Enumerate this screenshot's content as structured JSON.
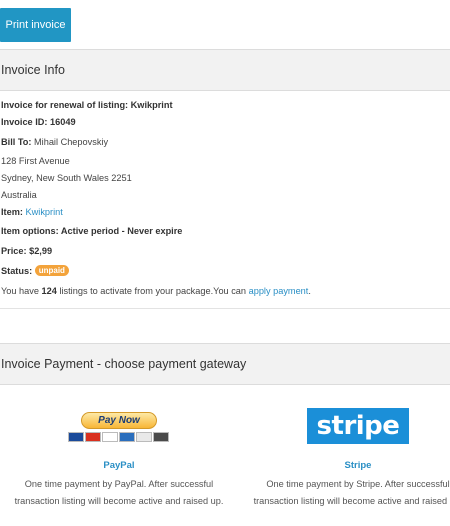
{
  "print_button": {
    "label": "Print invoice"
  },
  "invoice_info": {
    "heading": "Invoice Info",
    "renewal_line": "Invoice for renewal of listing: Kwikprint",
    "invoice_id_line": "Invoice ID: 16049",
    "bill_to_label": "Bill To:",
    "bill_to_name": "Mihail Chepovskiy",
    "address_line1": "128 First Avenue",
    "address_line2": "Sydney, New South Wales 2251",
    "address_line3": "Australia",
    "item_label": "Item:",
    "item_value": "Kwikprint",
    "item_options_line": "Item options: Active period - Never expire",
    "price_line": "Price: $2,99",
    "status_label": "Status:",
    "status_badge": "unpaid",
    "package_text_before": "You have",
    "package_count": "124",
    "package_text_after": "listings to activate from your package.You can",
    "package_link": "apply payment",
    "package_end": "."
  },
  "payment": {
    "heading": "Invoice Payment - choose payment gateway",
    "gateways": [
      {
        "name": "PayPal",
        "button_text": "Pay Now",
        "description": "One time payment by PayPal. After successful transaction listing will become active and raised up."
      },
      {
        "name": "Stripe",
        "logo_text": "stripe",
        "description": "One time payment by Stripe. After successful transaction listing will become active and raised up."
      }
    ]
  },
  "colors": {
    "primary_button": "#2196c4",
    "link": "#2a8fc5",
    "badge_unpaid": "#f3a33b",
    "stripe_brand": "#1b8fd8",
    "panel_heading_bg": "#f2f2f2"
  }
}
